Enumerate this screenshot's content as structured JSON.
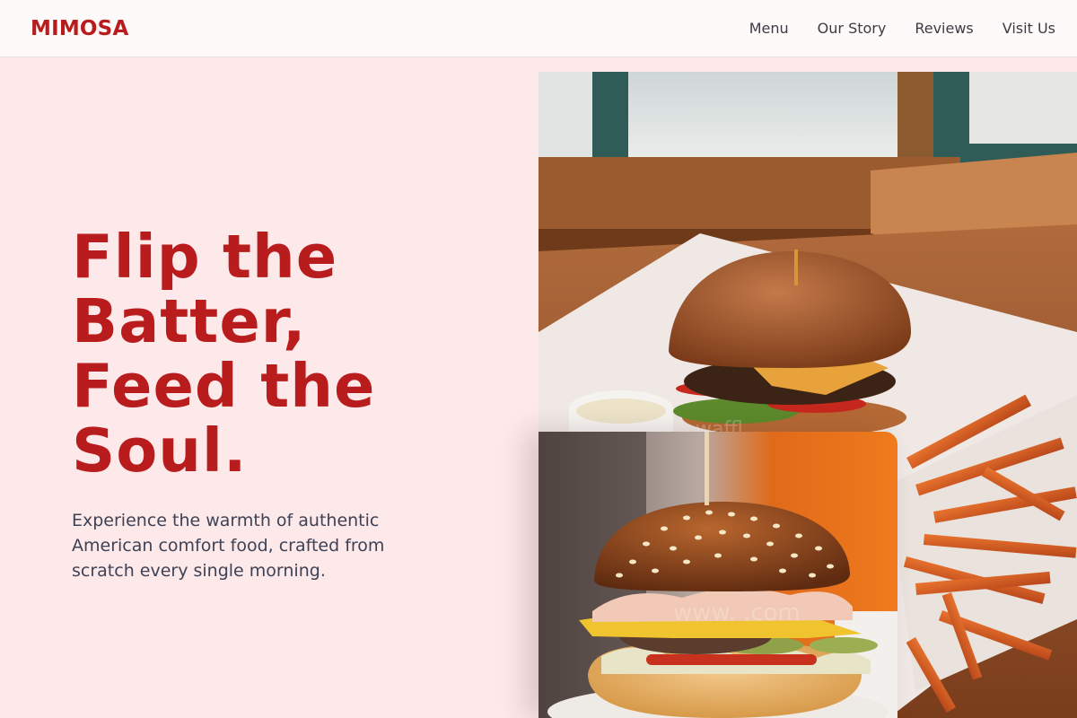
{
  "brand": {
    "name": "MIMOSA"
  },
  "nav": {
    "items": [
      {
        "label": "Menu"
      },
      {
        "label": "Our Story"
      },
      {
        "label": "Reviews"
      },
      {
        "label": "Visit Us"
      }
    ]
  },
  "hero": {
    "title_lines": [
      "Flip the",
      "Batter,",
      "Feed the",
      "Soul."
    ],
    "description": "Experience the warmth of authentic American comfort food, crafted from scratch every single morning."
  },
  "colors": {
    "accent": "#b91c1c",
    "background": "#fde8ea",
    "navbar_bg": "#fffafa"
  }
}
